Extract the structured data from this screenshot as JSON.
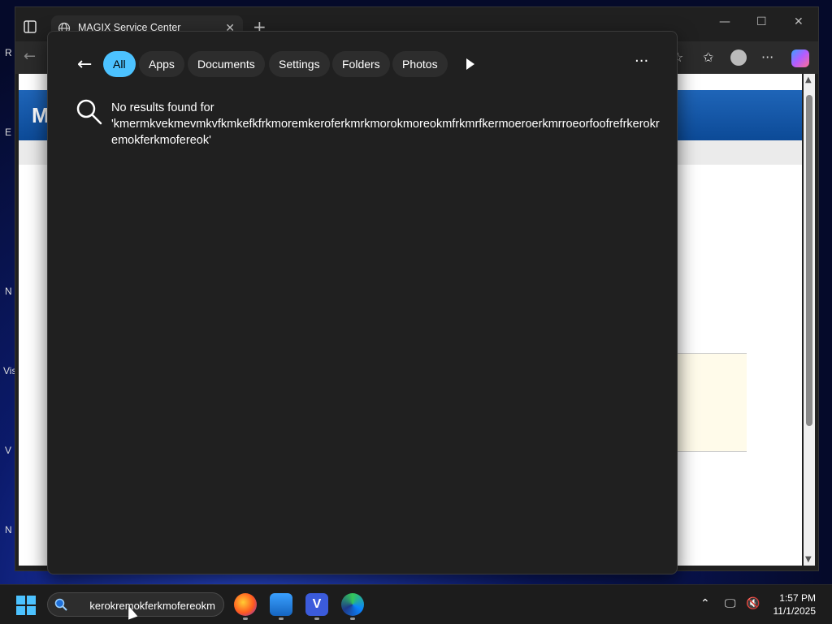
{
  "browser": {
    "tab_title": "MAGIX Service Center",
    "site_logo": "M"
  },
  "desktop": {
    "labels": [
      "R",
      "E",
      "N",
      "Vis",
      "V",
      "N"
    ]
  },
  "search_flyout": {
    "filters": [
      {
        "label": "All",
        "active": true
      },
      {
        "label": "Apps",
        "active": false
      },
      {
        "label": "Documents",
        "active": false
      },
      {
        "label": "Settings",
        "active": false
      },
      {
        "label": "Folders",
        "active": false
      },
      {
        "label": "Photos",
        "active": false
      }
    ],
    "no_results_prefix": "No results found for",
    "query_display": "'kmermkvekmevmkvfkmkefkfrkmoremkeroferkmrkmorokmoreokmfrkmrfkermoeroerkmrroeorfoofrefrkerokremokferkmofereok'",
    "menu_glyph": "···"
  },
  "taskbar": {
    "search_value": "kerokremokferkmofereokm",
    "time": "1:57 PM",
    "date": "11/1/2025"
  },
  "colors": {
    "accent": "#4cc2ff",
    "panel_bg": "#202020",
    "taskbar_bg": "#1c1c1c"
  }
}
